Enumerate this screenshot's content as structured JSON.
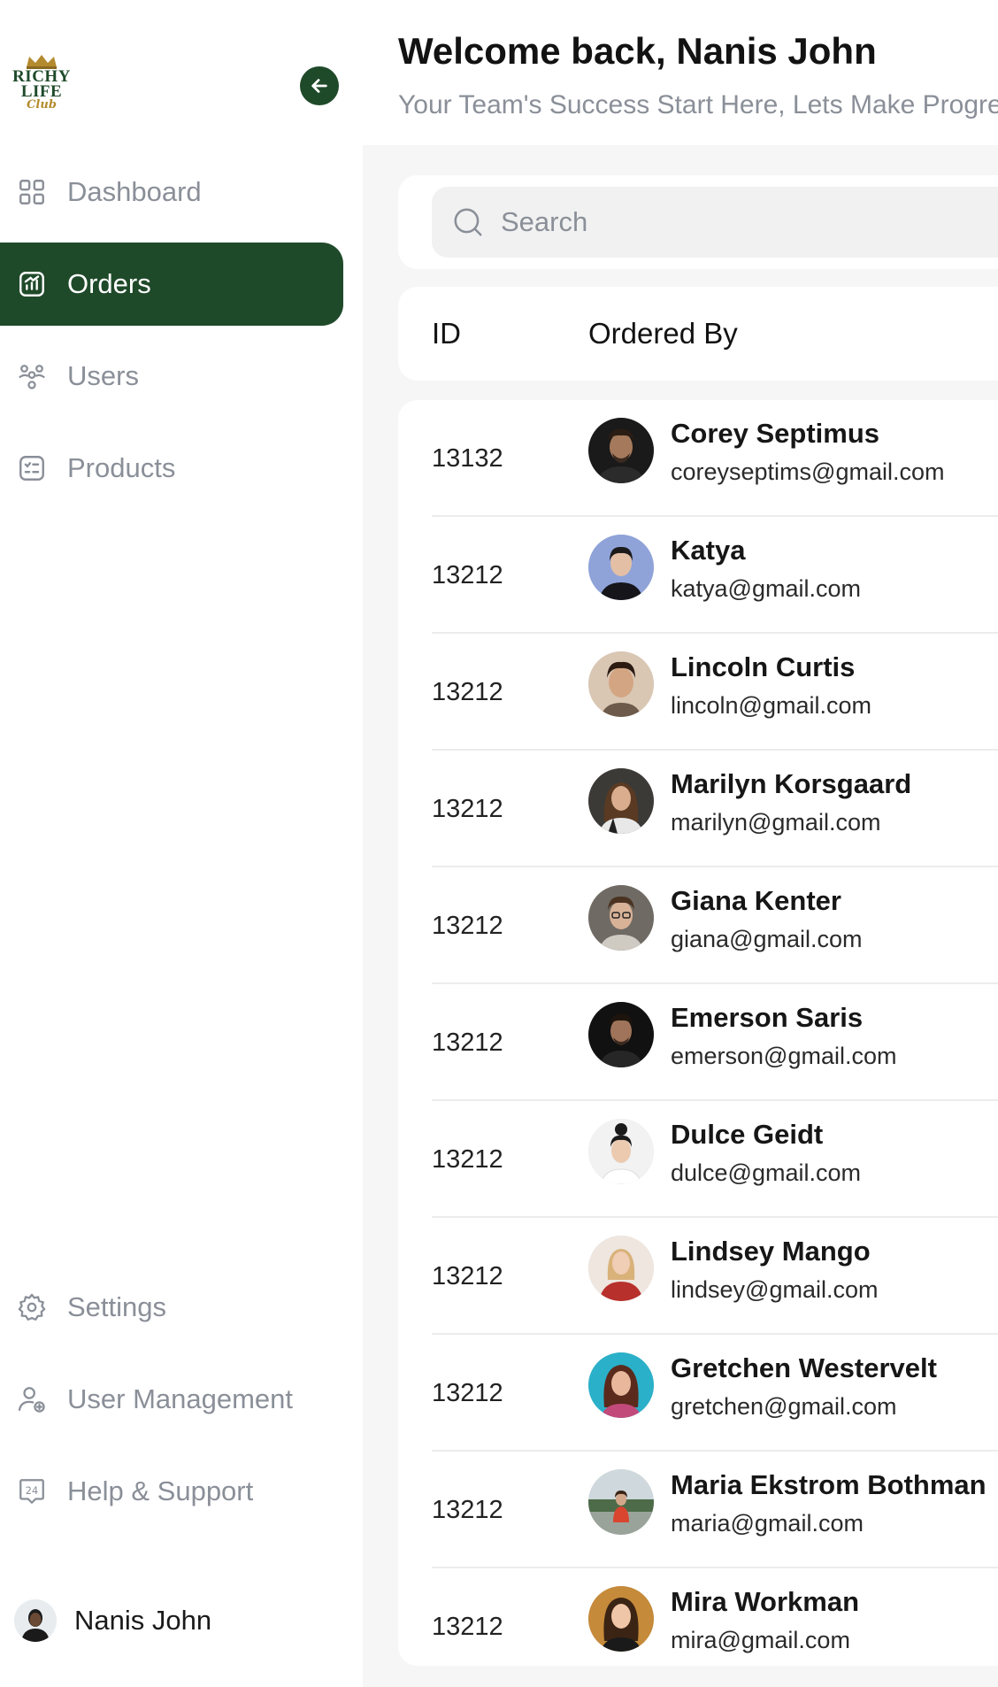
{
  "brand": {
    "line1": "RICHY",
    "line2": "LIFE",
    "script": "Club",
    "color": "#1f4a2a",
    "gold": "#b38a2e"
  },
  "sidebar": {
    "collapse_icon": "arrow-left-icon",
    "items": [
      {
        "label": "Dashboard",
        "icon": "grid-icon",
        "active": false
      },
      {
        "label": "Orders",
        "icon": "chart-icon",
        "active": true
      },
      {
        "label": "Users",
        "icon": "users-icon",
        "active": false
      },
      {
        "label": "Products",
        "icon": "checklist-icon",
        "active": false
      }
    ],
    "bottom_items": [
      {
        "label": "Settings",
        "icon": "gear-icon"
      },
      {
        "label": "User Management",
        "icon": "user-add-icon"
      },
      {
        "label": "Help & Support",
        "icon": "support-24-icon"
      }
    ],
    "profile": {
      "name": "Nanis John"
    }
  },
  "header": {
    "welcome": "Welcome back, Nanis John",
    "subtitle": "Your Team's Success Start Here, Lets Make Progre"
  },
  "search": {
    "placeholder": "Search",
    "value": ""
  },
  "table": {
    "columns": [
      "ID",
      "Ordered By"
    ],
    "rows": [
      {
        "id": "13132",
        "name": "Corey Septimus",
        "email": "coreyseptims@gmail.com"
      },
      {
        "id": "13212",
        "name": "Katya",
        "email": "katya@gmail.com"
      },
      {
        "id": "13212",
        "name": "Lincoln Curtis",
        "email": "lincoln@gmail.com"
      },
      {
        "id": "13212",
        "name": "Marilyn Korsgaard",
        "email": "marilyn@gmail.com"
      },
      {
        "id": "13212",
        "name": "Giana Kenter",
        "email": "giana@gmail.com"
      },
      {
        "id": "13212",
        "name": "Emerson Saris",
        "email": "emerson@gmail.com"
      },
      {
        "id": "13212",
        "name": "Dulce Geidt",
        "email": "dulce@gmail.com"
      },
      {
        "id": "13212",
        "name": "Lindsey Mango",
        "email": "lindsey@gmail.com"
      },
      {
        "id": "13212",
        "name": "Gretchen Westervelt",
        "email": "gretchen@gmail.com"
      },
      {
        "id": "13212",
        "name": "Maria Ekstrom Bothman",
        "email": "maria@gmail.com"
      },
      {
        "id": "13212",
        "name": "Mira Workman",
        "email": "mira@gmail.com"
      }
    ]
  }
}
